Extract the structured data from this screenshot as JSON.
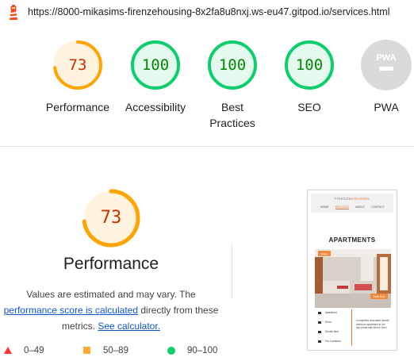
{
  "address_bar": {
    "url": "https://8000-mikasims-firenzehousing-8x2fa8u8nxj.ws-eu47.gitpod.io/services.html"
  },
  "summary_gauges": [
    {
      "score": "73",
      "label": "Performance",
      "color": "#ffa400"
    },
    {
      "score": "100",
      "label": "Accessibility",
      "color": "#0cce6b"
    },
    {
      "score": "100",
      "label": "Best Practices",
      "color": "#0cce6b"
    },
    {
      "score": "100",
      "label": "SEO",
      "color": "#0cce6b"
    },
    {
      "score": "PWA",
      "label": "PWA",
      "color": "#cccccc"
    }
  ],
  "performance": {
    "score": "73",
    "score_fraction": 0.73,
    "title": "Performance",
    "desc_line1": "Values are estimated and may vary. The",
    "link_calc": "performance score is calculated",
    "desc_line2_rest": " directly from these",
    "desc_line3": "metrics. ",
    "link_calculator": "See calculator."
  },
  "legend": [
    {
      "range": "0–49",
      "shape": "triangle",
      "color": "#ff3333"
    },
    {
      "range": "50–89",
      "shape": "square",
      "color": "#ffaa33"
    },
    {
      "range": "90–100",
      "shape": "circle",
      "color": "#0cce6b"
    }
  ],
  "thumbnail": {
    "brand_left": "FIRENZE",
    "brand_right": "HOUSING",
    "nav": [
      "HOME",
      "SERVICES",
      "ABOUT",
      "CONTACT"
    ],
    "heading": "APARTMENTS",
    "tag": "SALE",
    "button": "Book Now",
    "details": [
      "Apartment",
      "50 m²",
      "Double Bed",
      "For 2 persons"
    ],
    "description": "Completely renovated double bedroom apartment in the city center with Bruno Vero!"
  },
  "colors": {
    "orange": "#ffa400",
    "orange_text": "#c33300",
    "green": "#0cce6b",
    "green_text": "#008800",
    "link": "#1155cc"
  }
}
